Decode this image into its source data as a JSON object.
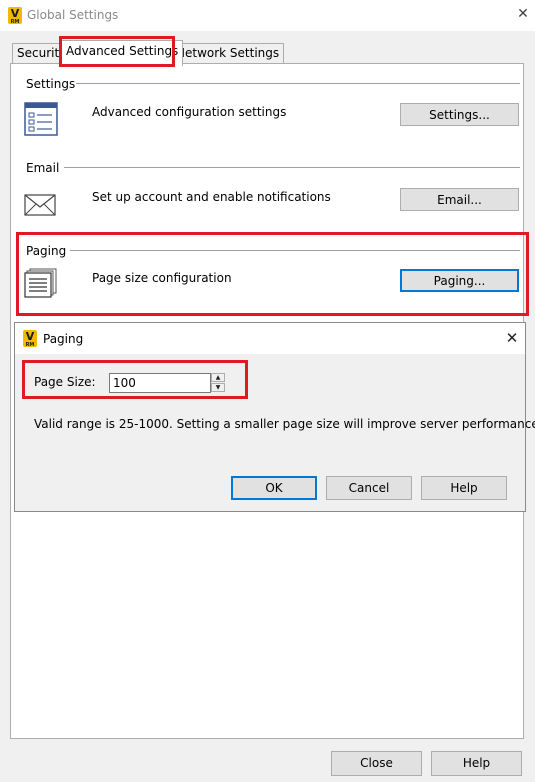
{
  "window": {
    "title": "Global Settings",
    "icon_letter": "V",
    "icon_sub": "RM",
    "close_glyph": "✕"
  },
  "tabs": [
    {
      "label": "Security",
      "selected": false
    },
    {
      "label": "Advanced Settings",
      "selected": true
    },
    {
      "label": "Network Settings",
      "selected": false
    }
  ],
  "sections": {
    "settings": {
      "label": "Settings",
      "description": "Advanced configuration settings",
      "button": "Settings...",
      "icon": "settings-list-icon"
    },
    "email": {
      "label": "Email",
      "description": "Set up account and enable notifications",
      "button": "Email...",
      "icon": "envelope-icon"
    },
    "paging": {
      "label": "Paging",
      "description": "Page size configuration",
      "button": "Paging...",
      "icon": "document-stack-icon"
    }
  },
  "dialog": {
    "title": "Paging",
    "close_glyph": "✕",
    "page_size_label": "Page Size:",
    "page_size_value": "100",
    "info": "Valid range is 25-1000.  Setting a smaller page size will improve server performance.",
    "buttons": {
      "ok": "OK",
      "cancel": "Cancel",
      "help": "Help"
    }
  },
  "footer": {
    "close": "Close",
    "help": "Help"
  },
  "colors": {
    "highlight": "#e01a22",
    "focus": "#0078d7",
    "app_icon": "#f5b800"
  }
}
